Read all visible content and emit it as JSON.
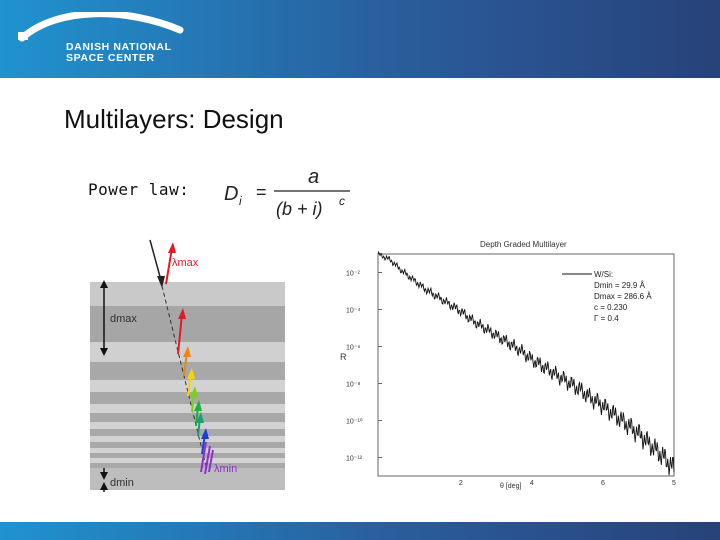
{
  "header": {
    "logo_line1": "DANISH NATIONAL",
    "logo_line2": "SPACE CENTER",
    "gradient_start": "#1f93cf",
    "gradient_end": "#28427a"
  },
  "slide": {
    "title": "Multilayers: Design",
    "power_law_label": "Power law:",
    "formula": {
      "lhs": "D",
      "lhs_sub": "i",
      "eq": "=",
      "numerator": "a",
      "den_open": "(b + i)",
      "den_exp": "c"
    }
  },
  "layer_diagram": {
    "lambda_max_label": "λmax",
    "lambda_min_label": "λmin",
    "d_max_label": "dmax",
    "d_min_label": "dmin"
  },
  "chart_data": {
    "type": "line",
    "title": "Depth Graded Multilayer",
    "xlabel": "θ [deg]",
    "ylabel": "R",
    "x_ticks": [
      "2",
      "4",
      "6",
      "5"
    ],
    "y_ticks": [
      "10⁻²",
      "10⁻⁴",
      "10⁻⁶",
      "10⁻⁸",
      "10⁻¹⁰",
      "10⁻¹²"
    ],
    "xlim": [
      0,
      5
    ],
    "ylim_log10": [
      -13,
      -1
    ],
    "legend": {
      "placement": "top-right",
      "entries": [
        "W/Si:",
        "Dmin = 29.9 Å",
        "Dmax = 286.6 Å",
        "c = 0.230",
        "Γ = 0.4"
      ]
    },
    "series": [
      {
        "x": [
          0,
          0.2,
          0.4,
          0.6,
          0.8,
          1.0,
          1.2,
          1.4,
          1.6,
          1.8,
          2.0,
          2.2,
          2.4,
          2.6,
          2.8,
          3.0,
          3.2,
          3.4,
          3.6,
          3.8,
          4.0,
          4.2,
          4.4,
          4.6,
          4.8,
          5.0
        ],
        "log10_y": [
          -1.0,
          -1.3,
          -1.9,
          -2.4,
          -2.9,
          -3.3,
          -3.7,
          -4.1,
          -4.6,
          -5.0,
          -5.4,
          -5.8,
          -6.2,
          -6.7,
          -7.1,
          -7.5,
          -7.9,
          -8.3,
          -8.8,
          -9.2,
          -9.7,
          -10.2,
          -10.7,
          -11.3,
          -11.9,
          -12.6
        ]
      }
    ]
  }
}
